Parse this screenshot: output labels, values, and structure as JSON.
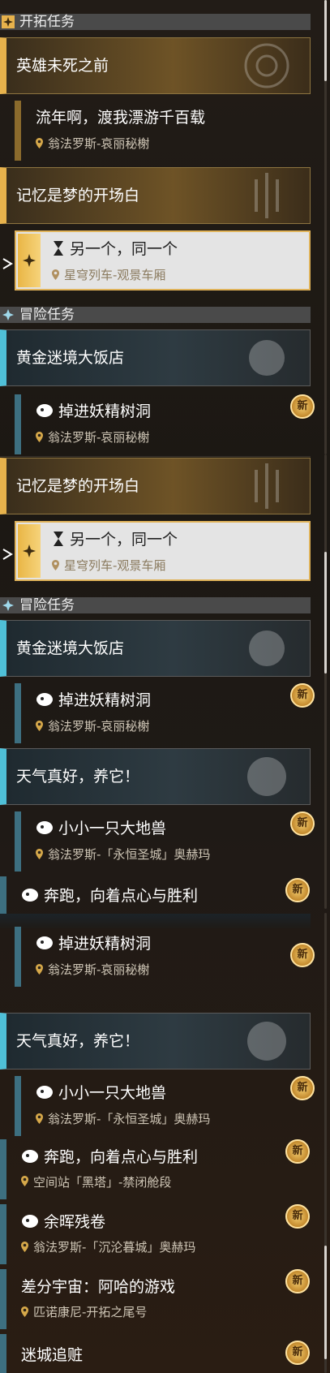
{
  "sections": {
    "trailblaze": "开拓任务",
    "adventure": "冒险任务"
  },
  "quests": {
    "hero": {
      "title": "英雄未死之前"
    },
    "drift": {
      "title": "流年啊，渡我漂游千百载",
      "location": "翁法罗斯-哀丽秘榭"
    },
    "memory": {
      "title": "记忆是梦的开场白"
    },
    "another": {
      "title": "另一个，同一个",
      "location": "星穹列车-观景车厢"
    },
    "golden": {
      "title": "黄金迷境大饭店"
    },
    "fairy": {
      "title": "掉进妖精树洞",
      "location": "翁法罗斯-哀丽秘榭"
    },
    "weather": {
      "title": "天气真好，养它！"
    },
    "beast": {
      "title": "小小一只大地兽",
      "location": "翁法罗斯-「永恒圣城」奥赫玛"
    },
    "run": {
      "title": "奔跑，向着点心与胜利",
      "location": "空间站「黑塔」-禁闭舱段"
    },
    "afterglow": {
      "title": "余晖残卷",
      "location": "翁法罗斯-「沉沦暮城」奥赫玛"
    },
    "diff": {
      "title": "差分宇宙：阿哈的游戏",
      "location": "匹诺康尼-开拓之尾号"
    },
    "maze": {
      "title": "迷城追赃"
    }
  },
  "badge": "新",
  "colors": {
    "gold": "#e7b24c",
    "blue": "#4fc0d8",
    "selected_bg": "#e4e4e4"
  }
}
